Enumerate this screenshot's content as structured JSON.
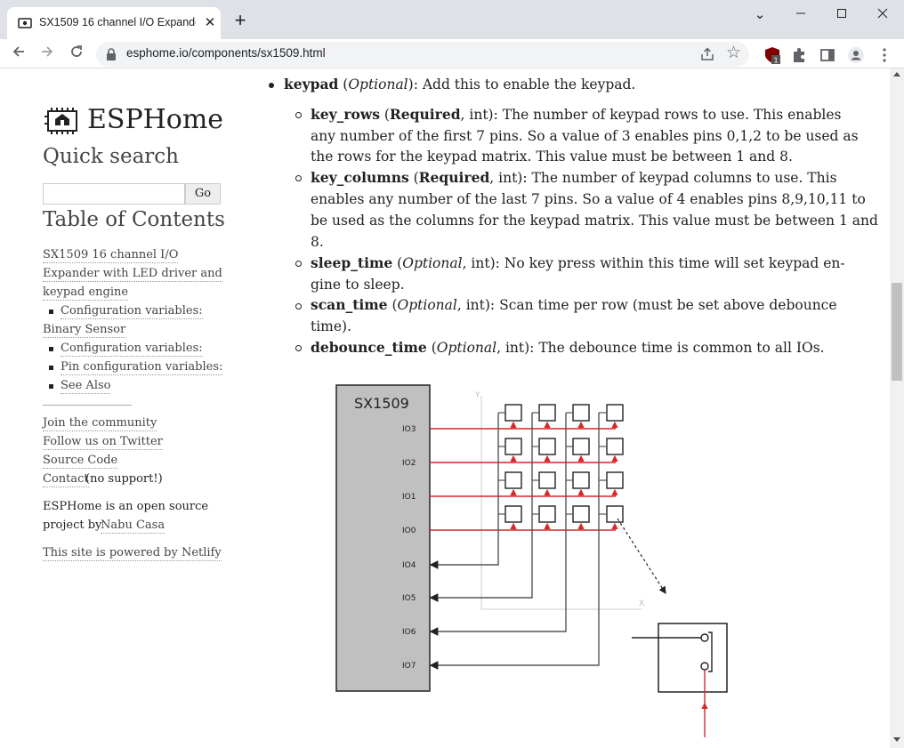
{
  "browser": {
    "tab_title": "SX1509 16 channel I/O Expander",
    "tab_close": "✕",
    "new_tab": "+",
    "url": "esphome.io/components/sx1509.html",
    "window_controls": {
      "minimize": "⌄",
      "restore": "—",
      "maximize": "☐",
      "close": "✕"
    },
    "extension_badge": "1"
  },
  "sidebar": {
    "logo_text": "ESPHome",
    "quick_search_title": "Quick search",
    "search_placeholder": "",
    "search_button": "Go",
    "toc_title": "Table of Contents",
    "toc_main_line1": "SX1509 16 channel I/O",
    "toc_main_line2": "Expander with LED driver and",
    "toc_main_line3": "keypad engine",
    "toc_config_vars_1": "Configuration variables:",
    "toc_binary_sensor": "Binary Sensor",
    "toc_config_vars_2": "Configuration variables:",
    "toc_pin_config": "Pin configuration variables:",
    "toc_see_also": "See Also",
    "join_community": "Join the community",
    "follow_twitter": "Follow us on Twitter",
    "source_code": "Source Code",
    "contact": "Contact",
    "contact_note": " (no support!)",
    "about_line1": "ESPHome is an open source",
    "about_line2_prefix": "project by ",
    "about_nabu": "Nabu Casa",
    "powered_by": "This site is powered by Netlify"
  },
  "content": {
    "keypad_name": "keypad",
    "keypad_rest_a": " (",
    "keypad_optional": "Optional",
    "keypad_rest_b": "): Add this to enable the keypad.",
    "key_rows_name": "key_rows",
    "key_rows_open": " (",
    "key_rows_req": "Required",
    "key_rows_l1": ", int): The number of keypad rows to use. This enables",
    "key_rows_l2": "any number of the first 7 pins. So a value of 3 enables pins 0,1,2 to be used as",
    "key_rows_l3": "the rows for the keypad matrix. This value must be between 1 and 8.",
    "key_columns_name": "key_columns",
    "key_columns_open": " (",
    "key_columns_req": "Required",
    "key_columns_l1": ", int): The number of keypad columns to use. This",
    "key_columns_l2": "enables any number of the last 7 pins. So a value of 4 enables pins 8,9,10,11 to",
    "key_columns_l3": "be used as the columns for the keypad matrix. This value must be between 1 and",
    "key_columns_l4": "8.",
    "sleep_time_name": "sleep_time",
    "sleep_time_open": " (",
    "sleep_time_opt": "Optional",
    "sleep_time_l1": ", int): No key press within this time will set keypad en-",
    "sleep_time_l2": "gine to sleep.",
    "scan_time_name": "scan_time",
    "scan_time_open": " (",
    "scan_time_opt": "Optional",
    "scan_time_l1": ", int): Scan time per row (must be set above debounce",
    "scan_time_l2": "time).",
    "debounce_time_name": "debounce_time",
    "debounce_time_open": " (",
    "debounce_time_opt": "Optional",
    "debounce_time_l1": ", int): The debounce time is common to all IOs."
  },
  "diagram": {
    "chip_label": "SX1509",
    "pins": [
      "IO3",
      "IO2",
      "IO1",
      "IO0",
      "IO4",
      "IO5",
      "IO6",
      "IO7"
    ],
    "axis_y": "Y",
    "axis_x": "X",
    "row_color": "#d9262a",
    "col_color": "#555555",
    "chip_fill": "#c0c0c0"
  },
  "icons": {
    "favicon": "esphome-favicon-icon",
    "lock": "lock-icon",
    "share": "share-icon",
    "star": "bookmark-star-icon",
    "ublock": "ublock-icon",
    "puzzle": "extensions-icon",
    "sidepanel": "side-panel-icon",
    "profile": "profile-icon",
    "menu": "kebab-menu-icon"
  }
}
